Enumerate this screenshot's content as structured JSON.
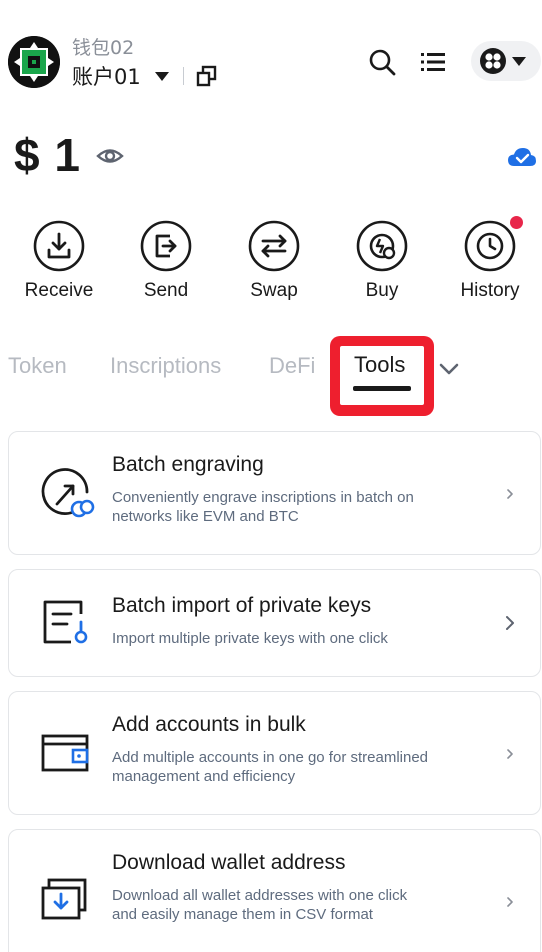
{
  "header": {
    "wallet_name": "钱包02",
    "account_name": "账户01",
    "icons": [
      "wallet-avatar",
      "caret-down-icon",
      "copy-icon",
      "search-icon",
      "menu-list-icon",
      "network-icon",
      "caret-down-icon"
    ]
  },
  "balance": {
    "amount": "$ 1",
    "icons": [
      "eye-icon",
      "cloud-icon"
    ]
  },
  "actions": [
    {
      "label": "Receive",
      "icon": "receive-icon"
    },
    {
      "label": "Send",
      "icon": "send-icon"
    },
    {
      "label": "Swap",
      "icon": "swap-icon"
    },
    {
      "label": "Buy",
      "icon": "buy-icon"
    },
    {
      "label": "History",
      "icon": "history-icon"
    }
  ],
  "tabs": {
    "items": [
      "Token",
      "Inscriptions",
      "DeFi",
      "Tools"
    ],
    "active": "Tools"
  },
  "tools": [
    {
      "title": "Batch engraving",
      "description": "Conveniently engrave inscriptions in batch on networks like EVM and BTC",
      "icon": "batch-engraving-icon"
    },
    {
      "title": "Batch import of private keys",
      "description": "Import multiple private keys with one click",
      "icon": "key-import-icon"
    },
    {
      "title": "Add accounts in bulk",
      "description": "Add multiple accounts in one go for streamlined management and efficiency",
      "icon": "wallet-icon"
    },
    {
      "title": "Download wallet address",
      "description": "Download all wallet addresses with one click and easily manage them in CSV format",
      "icon": "download-icon"
    }
  ],
  "colors": {
    "accent_blue": "#1f6fe5",
    "highlight_red": "#ee1f2e",
    "notification_red": "#e8264a",
    "muted_tab": "#b6bac1",
    "desc_text": "#5e6b7e"
  }
}
